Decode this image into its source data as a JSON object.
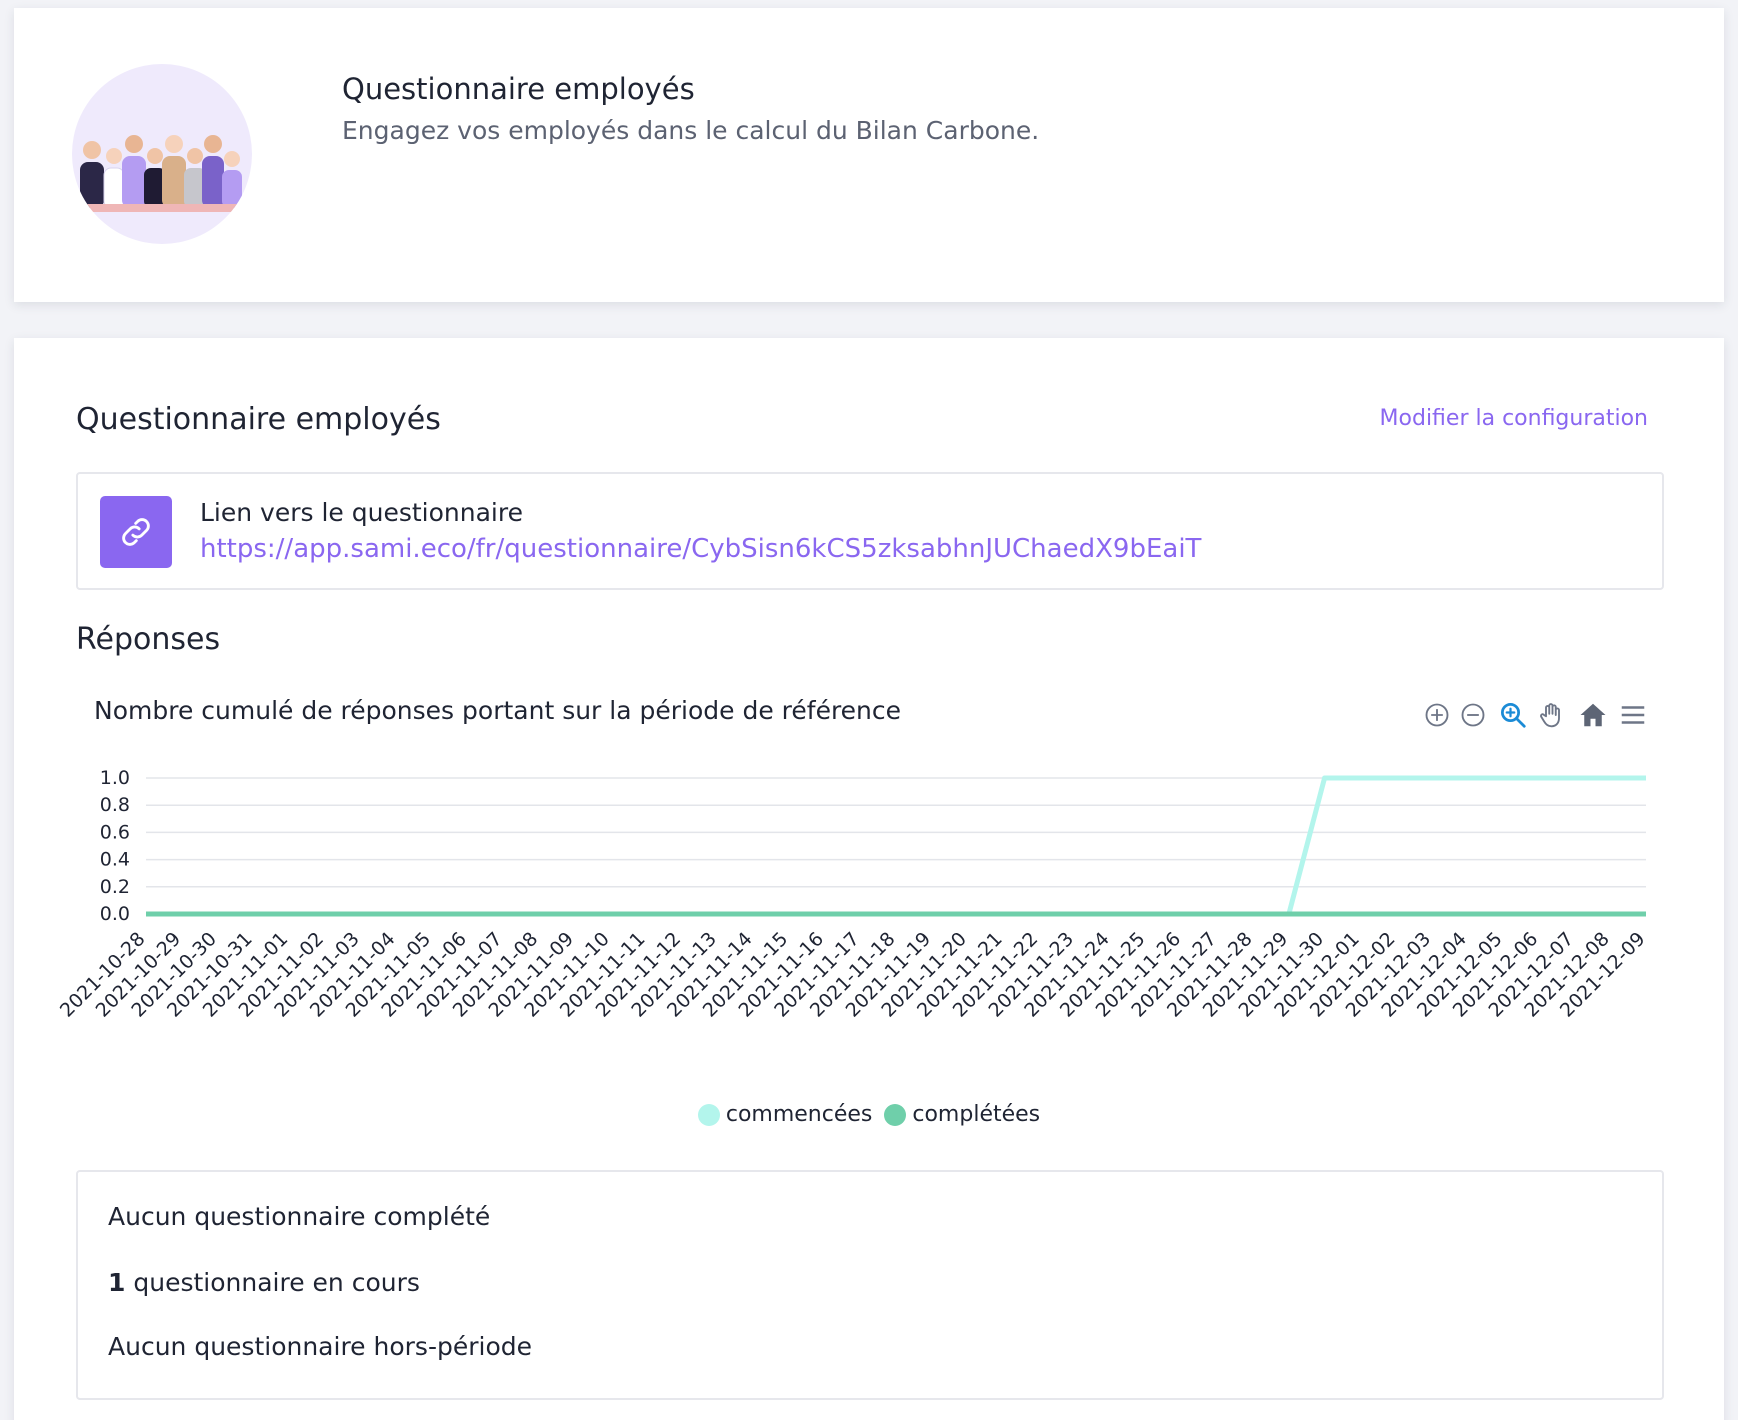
{
  "header": {
    "title": "Questionnaire employés",
    "subtitle": "Engagez vos employés dans le calcul du Bilan Carbone."
  },
  "main": {
    "title": "Questionnaire employés",
    "config_link": "Modifier la configuration",
    "link_box": {
      "label": "Lien vers le questionnaire",
      "url": "https://app.sami.eco/fr/questionnaire/CybSisn6kCS5zksabhnJUChaedX9bEaiT"
    },
    "responses_title": "Réponses"
  },
  "toolbar": {
    "icons": [
      "zoom-in-icon",
      "zoom-out-icon",
      "zoom-select-icon",
      "pan-hand-icon",
      "reset-home-icon",
      "menu-icon"
    ]
  },
  "chart_data": {
    "type": "line",
    "title": "Nombre cumulé de réponses portant sur la période de référence",
    "xlabel": "",
    "ylabel": "",
    "ylim": [
      0,
      1
    ],
    "yticks": [
      "0.0",
      "0.2",
      "0.4",
      "0.6",
      "0.8",
      "1.0"
    ],
    "x": [
      "2021-10-28",
      "2021-10-29",
      "2021-10-30",
      "2021-10-31",
      "2021-11-01",
      "2021-11-02",
      "2021-11-03",
      "2021-11-04",
      "2021-11-05",
      "2021-11-06",
      "2021-11-07",
      "2021-11-08",
      "2021-11-09",
      "2021-11-10",
      "2021-11-11",
      "2021-11-12",
      "2021-11-13",
      "2021-11-14",
      "2021-11-15",
      "2021-11-16",
      "2021-11-17",
      "2021-11-18",
      "2021-11-19",
      "2021-11-20",
      "2021-11-21",
      "2021-11-22",
      "2021-11-23",
      "2021-11-24",
      "2021-11-25",
      "2021-11-26",
      "2021-11-27",
      "2021-11-28",
      "2021-11-29",
      "2021-11-30",
      "2021-12-01",
      "2021-12-02",
      "2021-12-03",
      "2021-12-04",
      "2021-12-05",
      "2021-12-06",
      "2021-12-07",
      "2021-12-08",
      "2021-12-09"
    ],
    "series": [
      {
        "name": "commencées",
        "color": "#b3f5ec",
        "values": [
          0,
          0,
          0,
          0,
          0,
          0,
          0,
          0,
          0,
          0,
          0,
          0,
          0,
          0,
          0,
          0,
          0,
          0,
          0,
          0,
          0,
          0,
          0,
          0,
          0,
          0,
          0,
          0,
          0,
          0,
          0,
          0,
          0,
          1,
          1,
          1,
          1,
          1,
          1,
          1,
          1,
          1,
          1
        ]
      },
      {
        "name": "complétées",
        "color": "#6fcfaa",
        "values": [
          0,
          0,
          0,
          0,
          0,
          0,
          0,
          0,
          0,
          0,
          0,
          0,
          0,
          0,
          0,
          0,
          0,
          0,
          0,
          0,
          0,
          0,
          0,
          0,
          0,
          0,
          0,
          0,
          0,
          0,
          0,
          0,
          0,
          0,
          0,
          0,
          0,
          0,
          0,
          0,
          0,
          0,
          0
        ]
      }
    ],
    "grid": true,
    "legend": "bottom-center"
  },
  "summary": {
    "completed": "Aucun questionnaire complété",
    "in_progress_count": "1",
    "in_progress_text": " questionnaire en cours",
    "out_of_period": "Aucun questionnaire hors-période"
  },
  "colors": {
    "accent": "#8a67f0",
    "avatar_bg": "#efeafc"
  }
}
